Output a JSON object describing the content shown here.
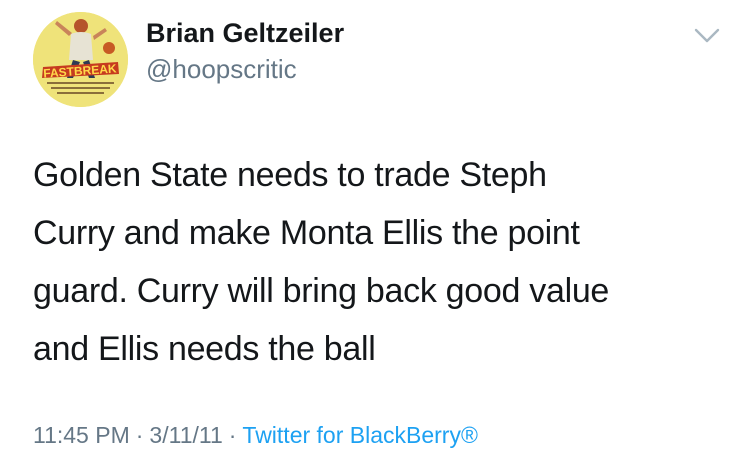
{
  "tweet": {
    "display_name": "Brian Geltzeiler",
    "handle": "@hoopscritic",
    "avatar_text": "FASTBREAK",
    "text_lines": [
      "Golden State needs to trade Steph",
      "Curry and make Monta Ellis the point",
      "guard.  Curry will bring back good value",
      "and Ellis needs the ball"
    ],
    "time": "11:45 PM",
    "separator": "·",
    "date": "3/11/11",
    "source": "Twitter for BlackBerry®"
  },
  "icons": {
    "menu": "chevron-down-icon"
  },
  "colors": {
    "text": "#14171a",
    "secondary": "#657786",
    "link": "#1da1f2",
    "caret": "#aab8c2"
  }
}
